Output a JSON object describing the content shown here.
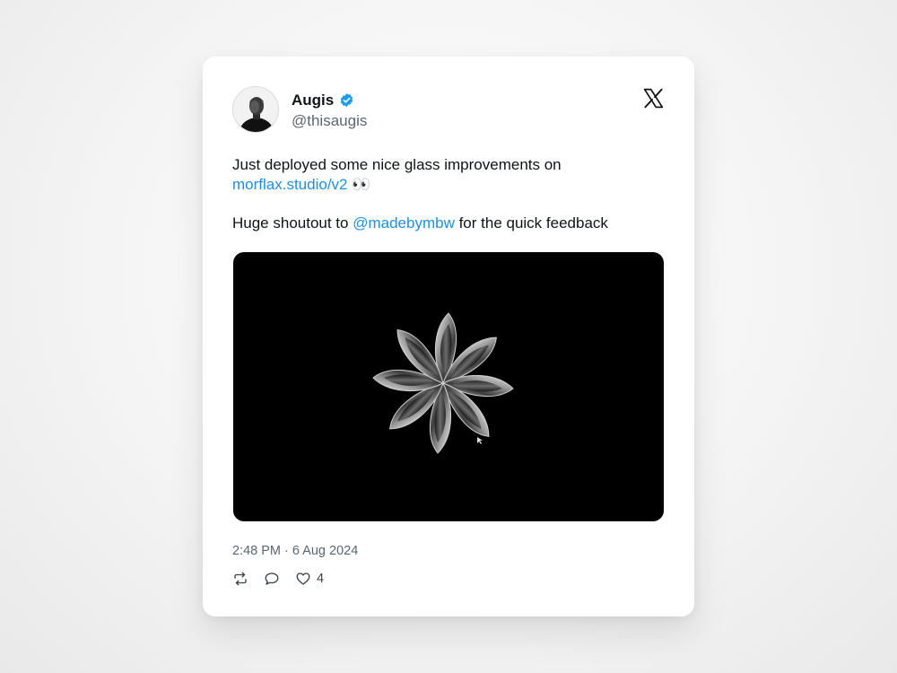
{
  "tweet": {
    "author": {
      "display_name": "Augis",
      "handle": "@thisaugis",
      "verified": true
    },
    "text": {
      "line1": "Just deployed some nice glass improvements on",
      "link": "morflax.studio/v2",
      "emoji": "👀",
      "line2_prefix": "Huge shoutout to ",
      "mention": "@madebymbw",
      "line2_suffix": " for the quick feedback"
    },
    "media": {
      "description_icon": "glass-flower-render"
    },
    "timestamp": "2:48 PM · 6 Aug 2024",
    "actions": {
      "like_count": "4"
    }
  },
  "colors": {
    "link": "#1d8fe0",
    "verified_badge": "#1d9bf0",
    "media_background": "#000000"
  },
  "icons": [
    "x-logo-icon",
    "verified-badge-icon",
    "retweet-icon",
    "reply-icon",
    "heart-icon"
  ]
}
